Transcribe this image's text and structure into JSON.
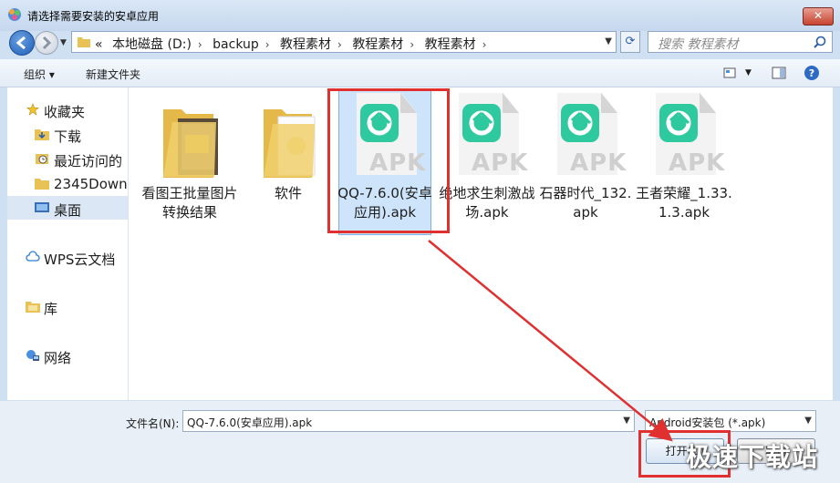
{
  "window": {
    "title": "请选择需要安装的安卓应用",
    "close_label": "✕"
  },
  "navigation": {
    "path_prefix": "«",
    "path": [
      "本地磁盘 (D:)",
      "backup",
      "教程素材",
      "教程素材",
      "教程素材"
    ],
    "search_placeholder": "搜索 教程素材"
  },
  "toolbar": {
    "organize_label": "组织 ▾",
    "new_folder_label": "新建文件夹"
  },
  "sidebar": {
    "items": [
      {
        "label": "收藏夹",
        "icon": "star-icon"
      },
      {
        "label": "下载",
        "icon": "download-folder-icon"
      },
      {
        "label": "最近访问的",
        "icon": "recent-icon"
      },
      {
        "label": "2345Down",
        "icon": "folder-icon"
      },
      {
        "label": "桌面",
        "icon": "desktop-icon",
        "selected": true
      },
      {
        "label": "WPS云文档",
        "icon": "cloud-icon"
      },
      {
        "label": "库",
        "icon": "library-icon"
      },
      {
        "label": "网络",
        "icon": "network-icon"
      }
    ]
  },
  "files": [
    {
      "name": "看图王批量图片转换结果",
      "type": "folder"
    },
    {
      "name": "软件",
      "type": "folder"
    },
    {
      "name": "QQ-7.6.0(安卓应用).apk",
      "type": "apk",
      "selected": true
    },
    {
      "name": "绝地求生刺激战场.apk",
      "type": "apk"
    },
    {
      "name": "石器时代_132.apk",
      "type": "apk"
    },
    {
      "name": "王者荣耀_1.33.1.3.apk",
      "type": "apk"
    }
  ],
  "apk_label": "APK",
  "bottom": {
    "filename_label": "文件名(N):",
    "filename_value": "QQ-7.6.0(安卓应用).apk",
    "filetype_value": "Android安装包 (*.apk)",
    "open_label": "打开(O)",
    "cancel_label": "取消"
  },
  "watermark": "极速下载站",
  "colors": {
    "annotation": "#e03030",
    "apk_logo": "#2fc9a0",
    "selection": "#cde4fb"
  }
}
